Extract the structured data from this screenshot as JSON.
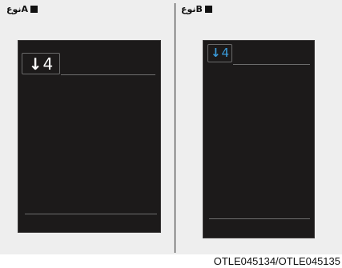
{
  "panels": {
    "a": {
      "label": "نوعA",
      "gear_arrow": "↓",
      "gear_number": "4",
      "gear_color": "#ffffff"
    },
    "b": {
      "label": "نوعB",
      "gear_arrow": "↓",
      "gear_number": "4",
      "gear_color": "#3a9ad9"
    }
  },
  "caption": "OTLE045134/OTLE045135",
  "icons": {
    "gear_shift": "down-arrow-icon",
    "label_marker": "square-marker-icon"
  }
}
